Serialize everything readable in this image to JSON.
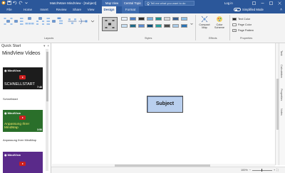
{
  "window": {
    "title": "MatchWare MindView - [Subject]",
    "context_tabs": [
      "Map View",
      "Central Topic"
    ],
    "search_placeholder": "Tell me what you want to do",
    "login": "Log in"
  },
  "ribbon_tabs": [
    "File",
    "Home",
    "Insert",
    "Review",
    "Share",
    "View",
    "Design",
    "Format"
  ],
  "active_tab": "Design",
  "simplified_mode": "Simplified Mode",
  "groups": {
    "layouts": "Layouts",
    "styles": "Styles",
    "effects": "Effects",
    "properties": "Properties"
  },
  "effects": {
    "compact_map": "Compact Map",
    "color_scheme": "Color Scheme"
  },
  "properties": {
    "text_color": "Text Color",
    "page_color": "Page Color",
    "page_pattern": "Page Pattern"
  },
  "panel": {
    "header": "Quick Start",
    "title": "MindView Videos",
    "videos": [
      {
        "caption": "SCHNELLSTART",
        "duration": "7:40",
        "label": "Schnellstart"
      },
      {
        "caption": "Anpassung Ihrer MindMap",
        "duration": "3:50",
        "label": "Anpassung Ihrer MindMap"
      },
      {
        "caption": "",
        "duration": "",
        "label": ""
      }
    ]
  },
  "canvas": {
    "central_topic": "Subject"
  },
  "right_tabs": [
    "Task",
    "Calculation",
    "Properties",
    "Notes"
  ],
  "status": {
    "zoom": "100%"
  },
  "colors": {
    "accent": "#2b579a",
    "topic_fill": "#b9cfee"
  }
}
